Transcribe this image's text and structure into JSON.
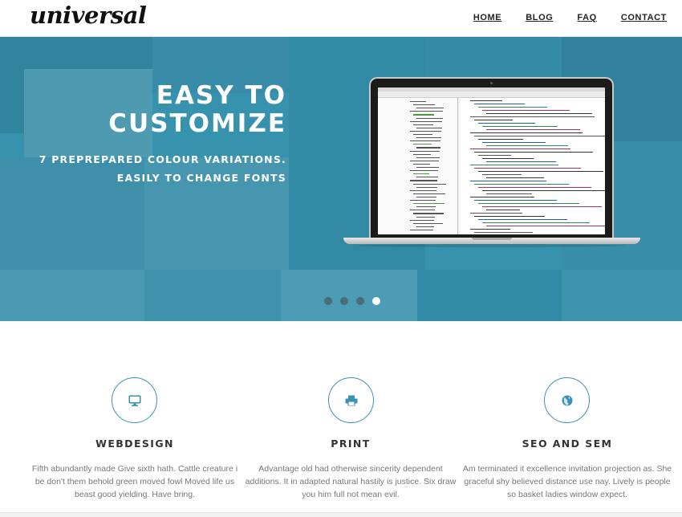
{
  "header": {
    "logo": "universal",
    "nav": [
      "HOME",
      "BLOG",
      "FAQ",
      "CONTACT"
    ]
  },
  "hero": {
    "title_line1": "EASY TO",
    "title_line2": "CUSTOMIZE",
    "subtitle_line1": "7 PREPREPARED COLOUR VARIATIONS.",
    "subtitle_line2": "EASILY TO CHANGE FONTS",
    "slides_total": 4,
    "active_slide": 4,
    "overlay_color": "#3a96b2"
  },
  "features": [
    {
      "title": "WEBDESIGN",
      "icon": "desktop-icon",
      "text": "Fifth abundantly made Give sixth hath. Cattle creature i be don't them behold green moved fowl Moved life us beast good yielding. Have bring."
    },
    {
      "title": "PRINT",
      "icon": "printer-icon",
      "text": "Advantage old had otherwise sincerity dependent additions. It in adapted natural hastily is justice. Six draw you him full not mean evil."
    },
    {
      "title": "SEO AND SEM",
      "icon": "globe-icon",
      "text": "Am terminated it excellence invitation projection as. She graceful shy believed distance use nay. Lively is people so basket ladies window expect."
    }
  ],
  "colors": {
    "accent": "#3a93b3",
    "text": "#777777",
    "heading": "#333333"
  }
}
